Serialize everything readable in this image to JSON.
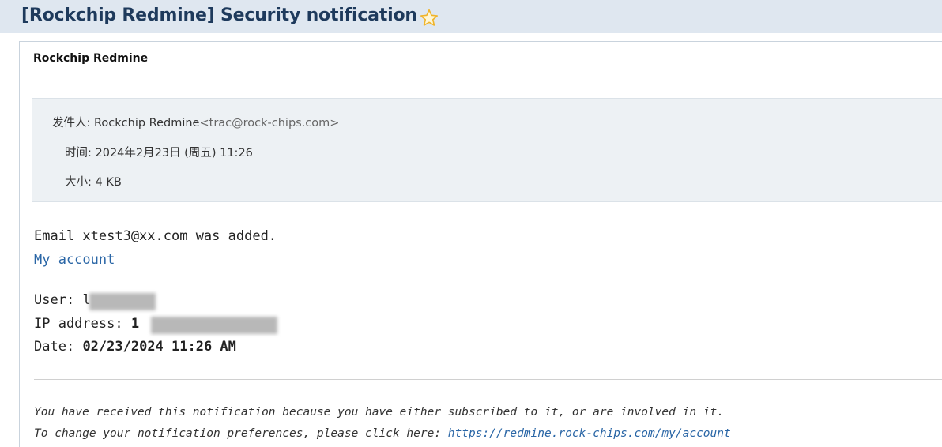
{
  "header": {
    "subject": "[Rockchip Redmine] Security notification",
    "star_icon": "star-outline-icon",
    "star_color": "#f0b429"
  },
  "message": {
    "sender_display_name": "Rockchip Redmine",
    "meta": {
      "from_label": "发件人:",
      "from_name": "Rockchip Redmine",
      "from_email": "<trac@rock-chips.com>",
      "time_label": "时间:",
      "time_value": "2024年2月23日 (周五) 11:26",
      "size_label": "大小:",
      "size_value": "4 KB"
    },
    "body": {
      "email_added": "Email xtest3@xx.com was added.",
      "account_link": "My account",
      "user_label": "User:",
      "user_visible": "l",
      "ip_label": "IP address:",
      "ip_visible": "1",
      "date_label": "Date:",
      "date_value": "02/23/2024 11:26 AM"
    },
    "footer": {
      "line1": "You have received this notification because you have either subscribed to it, or are involved in it.",
      "line2_prefix": "To change your notification preferences, please click here:",
      "line2_link": "https://redmine.rock-chips.com/my/account"
    },
    "link_color": "#2a66a6"
  }
}
